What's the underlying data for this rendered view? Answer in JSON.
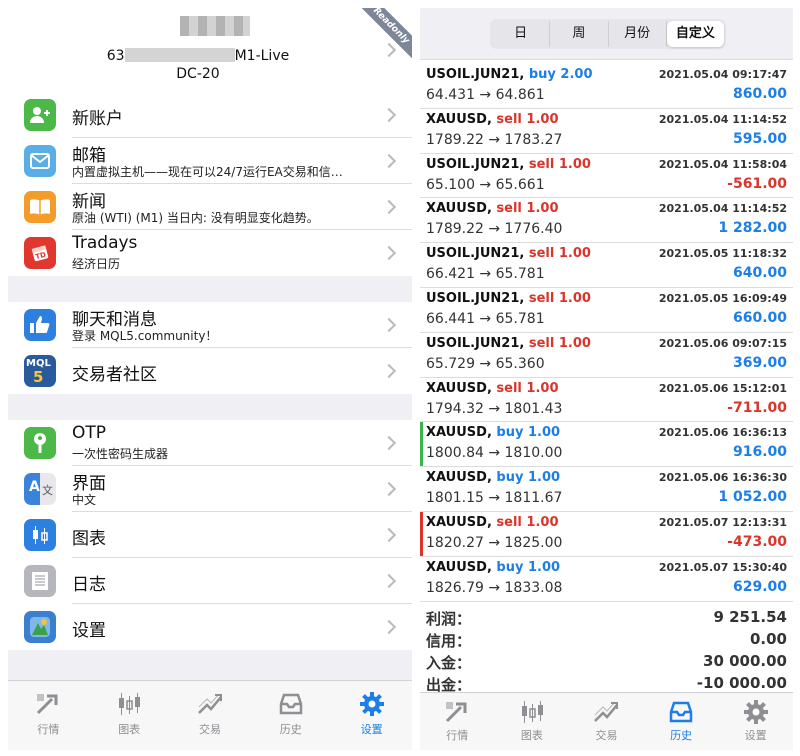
{
  "left": {
    "account": {
      "prefix": "63",
      "suffix": "M1-Live",
      "server": "DC-20",
      "badge": "Readonly"
    },
    "group1": [
      {
        "title": "新账户",
        "subtitle": "",
        "icon": "add-user-icon",
        "color": "#4cb848"
      },
      {
        "title": "邮箱",
        "subtitle": "内置虚拟主机——现在可以24/7运行EA交易和信…",
        "icon": "mail-icon",
        "color": "#5aaee8"
      },
      {
        "title": "新闻",
        "subtitle": "原油 (WTI) (M1) 当日内: 没有明显变化趋势。",
        "icon": "book-icon",
        "color": "#f39c2a"
      },
      {
        "title": "Tradays",
        "subtitle": "经济日历",
        "icon": "calendar-icon",
        "color": "#e0382e"
      }
    ],
    "group2": [
      {
        "title": "聊天和消息",
        "subtitle": "登录 MQL5.community！",
        "icon": "thumbs-up-icon",
        "color": "#2d7fe0"
      },
      {
        "title": "交易者社区",
        "subtitle": "",
        "icon": "mql5-icon",
        "color": "#2b5a9c",
        "icon_text": "MQL",
        "icon_num": "5"
      }
    ],
    "group3": [
      {
        "title": "OTP",
        "subtitle": "一次性密码生成器",
        "icon": "key-icon",
        "color": "#4cb848"
      },
      {
        "title": "界面",
        "subtitle": "中文",
        "icon": "language-icon",
        "color": "#3b83d9",
        "icon_text": "A",
        "icon_text2": "文"
      },
      {
        "title": "图表",
        "subtitle": "",
        "icon": "candlestick-icon",
        "color": "#2d7fe0"
      },
      {
        "title": "日志",
        "subtitle": "",
        "icon": "journal-icon",
        "color": "#b5b7bd"
      },
      {
        "title": "设置",
        "subtitle": "",
        "icon": "settings-icon",
        "color": "#3a7fd0"
      }
    ],
    "tabs": [
      {
        "label": "行情",
        "icon": "quotes-icon",
        "active": false
      },
      {
        "label": "图表",
        "icon": "chart-icon",
        "active": false
      },
      {
        "label": "交易",
        "icon": "trade-icon",
        "active": false
      },
      {
        "label": "历史",
        "icon": "history-icon",
        "active": false
      },
      {
        "label": "设置",
        "icon": "gear-icon",
        "active": true
      }
    ]
  },
  "right": {
    "segments": [
      "日",
      "周",
      "月份",
      "自定义"
    ],
    "selected_segment": 3,
    "deals": [
      {
        "symbol": "USOIL.JUN21,",
        "side": "buy",
        "side_text": "buy 2.00",
        "time": "2021.05.04 09:17:47",
        "prices": "64.431 → 64.861",
        "profit": "860.00",
        "mark": ""
      },
      {
        "symbol": "XAUUSD,",
        "side": "sell",
        "side_text": "sell 1.00",
        "time": "2021.05.04 11:14:52",
        "prices": "1789.22 → 1783.27",
        "profit": "595.00",
        "mark": ""
      },
      {
        "symbol": "USOIL.JUN21,",
        "side": "sell",
        "side_text": "sell 1.00",
        "time": "2021.05.04 11:58:04",
        "prices": "65.100 → 65.661",
        "profit": "-561.00",
        "mark": ""
      },
      {
        "symbol": "XAUUSD,",
        "side": "sell",
        "side_text": "sell 1.00",
        "time": "2021.05.04 11:14:52",
        "prices": "1789.22 → 1776.40",
        "profit": "1 282.00",
        "mark": ""
      },
      {
        "symbol": "USOIL.JUN21,",
        "side": "sell",
        "side_text": "sell 1.00",
        "time": "2021.05.05 11:18:32",
        "prices": "66.421 → 65.781",
        "profit": "640.00",
        "mark": ""
      },
      {
        "symbol": "USOIL.JUN21,",
        "side": "sell",
        "side_text": "sell 1.00",
        "time": "2021.05.05 16:09:49",
        "prices": "66.441 → 65.781",
        "profit": "660.00",
        "mark": ""
      },
      {
        "symbol": "USOIL.JUN21,",
        "side": "sell",
        "side_text": "sell 1.00",
        "time": "2021.05.06 09:07:15",
        "prices": "65.729 → 65.360",
        "profit": "369.00",
        "mark": ""
      },
      {
        "symbol": "XAUUSD,",
        "side": "sell",
        "side_text": "sell 1.00",
        "time": "2021.05.06 15:12:01",
        "prices": "1794.32 → 1801.43",
        "profit": "-711.00",
        "mark": ""
      },
      {
        "symbol": "XAUUSD,",
        "side": "buy",
        "side_text": "buy 1.00",
        "time": "2021.05.06 16:36:13",
        "prices": "1800.84 → 1810.00",
        "profit": "916.00",
        "mark": "#3bb54a"
      },
      {
        "symbol": "XAUUSD,",
        "side": "buy",
        "side_text": "buy 1.00",
        "time": "2021.05.06 16:36:30",
        "prices": "1801.15 → 1811.67",
        "profit": "1 052.00",
        "mark": ""
      },
      {
        "symbol": "XAUUSD,",
        "side": "sell",
        "side_text": "sell 1.00",
        "time": "2021.05.07 12:13:31",
        "prices": "1820.27 → 1825.00",
        "profit": "-473.00",
        "mark": "#d9352b"
      },
      {
        "symbol": "XAUUSD,",
        "side": "buy",
        "side_text": "buy 1.00",
        "time": "2021.05.07 15:30:40",
        "prices": "1826.79 → 1833.08",
        "profit": "629.00",
        "mark": ""
      }
    ],
    "summary": [
      {
        "label": "利润：",
        "value": "9 251.54"
      },
      {
        "label": "信用：",
        "value": "0.00"
      },
      {
        "label": "入金：",
        "value": "30 000.00"
      },
      {
        "label": "出金：",
        "value": "-10 000.00"
      }
    ],
    "tabs": [
      {
        "label": "行情",
        "icon": "quotes-icon",
        "active": false
      },
      {
        "label": "图表",
        "icon": "chart-icon",
        "active": false
      },
      {
        "label": "交易",
        "icon": "trade-icon",
        "active": false
      },
      {
        "label": "历史",
        "icon": "history-icon",
        "active": true
      },
      {
        "label": "设置",
        "icon": "gear-icon",
        "active": false
      }
    ]
  },
  "colors": {
    "accent": "#1c7ee6",
    "loss": "#d9352b",
    "inactive": "#8e8e93"
  }
}
